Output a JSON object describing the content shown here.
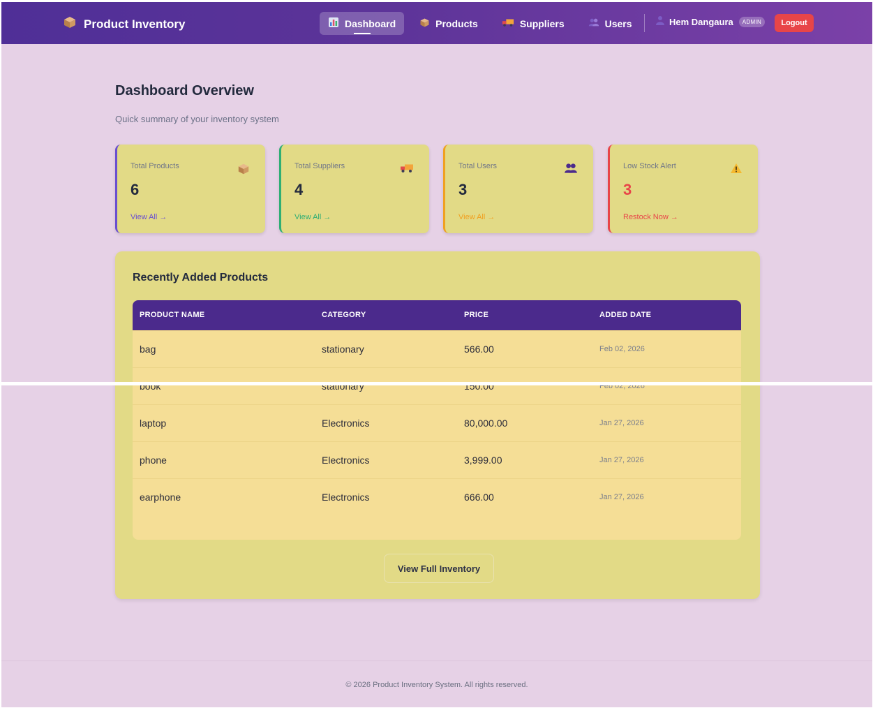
{
  "navbar": {
    "brand": "Product Inventory",
    "links": [
      {
        "label": "Dashboard",
        "icon": "chart-icon",
        "active": true
      },
      {
        "label": "Products",
        "icon": "box-icon",
        "active": false
      },
      {
        "label": "Suppliers",
        "icon": "truck-icon",
        "active": false
      },
      {
        "label": "Users",
        "icon": "users-icon",
        "active": false
      }
    ],
    "user_name": "Hem Dangaura",
    "role": "ADMIN",
    "logout_label": "Logout"
  },
  "header": {
    "title": "Dashboard Overview",
    "subtitle": "Quick summary of your inventory system"
  },
  "stats": [
    {
      "label": "Total Products",
      "value": "6",
      "link": "View All →",
      "icon": "box-icon",
      "accent": "#6a4fd0"
    },
    {
      "label": "Total Suppliers",
      "value": "4",
      "link": "View All →",
      "icon": "truck-icon",
      "accent": "#2fae74"
    },
    {
      "label": "Total Users",
      "value": "3",
      "link": "View All →",
      "icon": "users-icon",
      "accent": "#f0a020"
    },
    {
      "label": "Low Stock Alert",
      "value": "3",
      "link": "Restock Now →",
      "icon": "warning-icon",
      "accent": "#e84548"
    }
  ],
  "recent": {
    "title": "Recently Added Products",
    "columns": [
      "PRODUCT NAME",
      "CATEGORY",
      "PRICE",
      "ADDED DATE"
    ],
    "rows": [
      {
        "name": "bag",
        "category": "stationary",
        "price": "566.00",
        "date": "Feb 02, 2026"
      },
      {
        "name": "book",
        "category": "stationary",
        "price": "150.00",
        "date": "Feb 02, 2026"
      },
      {
        "name": "laptop",
        "category": "Electronics",
        "price": "80,000.00",
        "date": "Jan 27, 2026"
      },
      {
        "name": "phone",
        "category": "Electronics",
        "price": "3,999.00",
        "date": "Jan 27, 2026"
      },
      {
        "name": "earphone",
        "category": "Electronics",
        "price": "666.00",
        "date": "Jan 27, 2026"
      }
    ],
    "button_label": "View Full Inventory"
  },
  "footer": {
    "text": "© 2026 Product Inventory System. All rights reserved."
  }
}
